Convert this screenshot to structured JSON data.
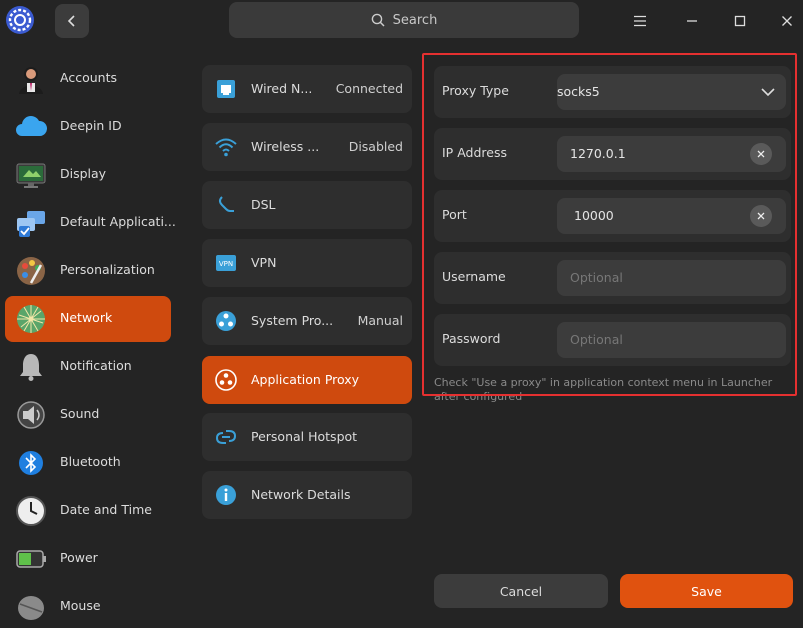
{
  "search": {
    "label": "Search"
  },
  "sidebar": {
    "items": [
      {
        "label": "Accounts",
        "icon": "accounts-icon"
      },
      {
        "label": "Deepin ID",
        "icon": "cloud-icon"
      },
      {
        "label": "Display",
        "icon": "display-icon"
      },
      {
        "label": "Default Applicati...",
        "icon": "default-apps-icon"
      },
      {
        "label": "Personalization",
        "icon": "palette-icon"
      },
      {
        "label": "Network",
        "icon": "network-icon",
        "active": true
      },
      {
        "label": "Notification",
        "icon": "bell-icon"
      },
      {
        "label": "Sound",
        "icon": "speaker-icon"
      },
      {
        "label": "Bluetooth",
        "icon": "bluetooth-icon"
      },
      {
        "label": "Date and Time",
        "icon": "clock-icon"
      },
      {
        "label": "Power",
        "icon": "battery-icon"
      },
      {
        "label": "Mouse",
        "icon": "mouse-icon"
      }
    ]
  },
  "network_list": {
    "items": [
      {
        "label": "Wired N...",
        "status": "Connected"
      },
      {
        "label": "Wireless ...",
        "status": "Disabled"
      },
      {
        "label": "DSL",
        "status": ""
      },
      {
        "label": "VPN",
        "status": "",
        "icon_text": "VPN"
      },
      {
        "label": "System Pro...",
        "status": "Manual"
      },
      {
        "label": "Application Proxy",
        "status": "",
        "active": true
      },
      {
        "label": "Personal Hotspot",
        "status": ""
      },
      {
        "label": "Network Details",
        "status": ""
      }
    ]
  },
  "proxy_form": {
    "proxy_type_label": "Proxy Type",
    "proxy_type_value": "socks5",
    "ip_label": "IP Address",
    "ip_value": "1270.0.1",
    "port_label": "Port",
    "port_value": "10000",
    "username_label": "Username",
    "username_placeholder": "Optional",
    "password_label": "Password",
    "password_placeholder": "Optional",
    "hint": "Check \"Use a proxy\" in application context menu in Launcher after configured"
  },
  "buttons": {
    "cancel": "Cancel",
    "save": "Save"
  },
  "colors": {
    "accent": "#cf4a0e",
    "save": "#e0520f",
    "highlight": "#e53030"
  }
}
